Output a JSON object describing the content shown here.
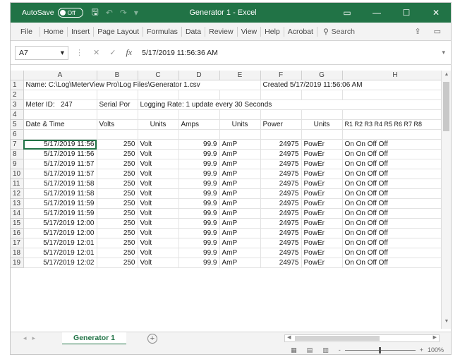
{
  "titlebar": {
    "autosave_label": "AutoSave",
    "autosave_state": "Off",
    "title": "Generator 1 - Excel",
    "controls": [
      "▭",
      "—",
      "☐",
      "✕"
    ]
  },
  "ribbon": {
    "tabs": [
      "File",
      "Home",
      "Insert",
      "Page Layout",
      "Formulas",
      "Data",
      "Review",
      "View",
      "Help",
      "Acrobat"
    ],
    "search_label": "Search"
  },
  "formula_bar": {
    "name_box": "A7",
    "fx_label": "fx",
    "value": "5/17/2019 11:56:36 AM"
  },
  "grid": {
    "columns": [
      "A",
      "B",
      "C",
      "D",
      "E",
      "F",
      "G",
      "H"
    ],
    "row1": {
      "a": "Name: C:\\Log\\MeterView Pro\\Log Files\\Generator 1.csv",
      "f": "Created 5/17/2019 11:56:06 AM"
    },
    "row3": {
      "a": "Meter ID:",
      "a2": "247",
      "b": "Serial Por",
      "c": "Logging Rate: 1 update every 30 Seconds"
    },
    "row5": {
      "a": "Date & Time",
      "b": "Volts",
      "c": "Units",
      "d": "Amps",
      "e": "Units",
      "f": "Power",
      "g": "Units",
      "h": "R1  R2  R3  R4  R5  R6  R7  R8"
    },
    "data_rows": [
      {
        "n": "7",
        "t": "5/17/2019 11:56",
        "v": "250",
        "vu": "Volt",
        "a": "99.9",
        "au": "AmP",
        "p": "24975",
        "pu": "PowEr",
        "r": "On  On  Off Off"
      },
      {
        "n": "8",
        "t": "5/17/2019 11:56",
        "v": "250",
        "vu": "Volt",
        "a": "99.9",
        "au": "AmP",
        "p": "24975",
        "pu": "PowEr",
        "r": "On  On  Off Off"
      },
      {
        "n": "9",
        "t": "5/17/2019 11:57",
        "v": "250",
        "vu": "Volt",
        "a": "99.9",
        "au": "AmP",
        "p": "24975",
        "pu": "PowEr",
        "r": "On  On  Off Off"
      },
      {
        "n": "10",
        "t": "5/17/2019 11:57",
        "v": "250",
        "vu": "Volt",
        "a": "99.9",
        "au": "AmP",
        "p": "24975",
        "pu": "PowEr",
        "r": "On  On  Off Off"
      },
      {
        "n": "11",
        "t": "5/17/2019 11:58",
        "v": "250",
        "vu": "Volt",
        "a": "99.9",
        "au": "AmP",
        "p": "24975",
        "pu": "PowEr",
        "r": "On  On  Off Off"
      },
      {
        "n": "12",
        "t": "5/17/2019 11:58",
        "v": "250",
        "vu": "Volt",
        "a": "99.9",
        "au": "AmP",
        "p": "24975",
        "pu": "PowEr",
        "r": "On  On  Off Off"
      },
      {
        "n": "13",
        "t": "5/17/2019 11:59",
        "v": "250",
        "vu": "Volt",
        "a": "99.9",
        "au": "AmP",
        "p": "24975",
        "pu": "PowEr",
        "r": "On  On  Off Off"
      },
      {
        "n": "14",
        "t": "5/17/2019 11:59",
        "v": "250",
        "vu": "Volt",
        "a": "99.9",
        "au": "AmP",
        "p": "24975",
        "pu": "PowEr",
        "r": "On  On  Off Off"
      },
      {
        "n": "15",
        "t": "5/17/2019 12:00",
        "v": "250",
        "vu": "Volt",
        "a": "99.9",
        "au": "AmP",
        "p": "24975",
        "pu": "PowEr",
        "r": "On  On  Off Off"
      },
      {
        "n": "16",
        "t": "5/17/2019 12:00",
        "v": "250",
        "vu": "Volt",
        "a": "99.9",
        "au": "AmP",
        "p": "24975",
        "pu": "PowEr",
        "r": "On  On  Off Off"
      },
      {
        "n": "17",
        "t": "5/17/2019 12:01",
        "v": "250",
        "vu": "Volt",
        "a": "99.9",
        "au": "AmP",
        "p": "24975",
        "pu": "PowEr",
        "r": "On  On  Off Off"
      },
      {
        "n": "18",
        "t": "5/17/2019 12:01",
        "v": "250",
        "vu": "Volt",
        "a": "99.9",
        "au": "AmP",
        "p": "24975",
        "pu": "PowEr",
        "r": "On  On  Off Off"
      },
      {
        "n": "19",
        "t": "5/17/2019 12:02",
        "v": "250",
        "vu": "Volt",
        "a": "99.9",
        "au": "AmP",
        "p": "24975",
        "pu": "PowEr",
        "r": "On  On  Off Off"
      }
    ]
  },
  "sheets": {
    "active": "Generator 1",
    "add_label": "+"
  },
  "status": {
    "zoom": "100%",
    "zoom_minus": "-",
    "zoom_plus": "+"
  },
  "colors": {
    "accent": "#217346"
  }
}
